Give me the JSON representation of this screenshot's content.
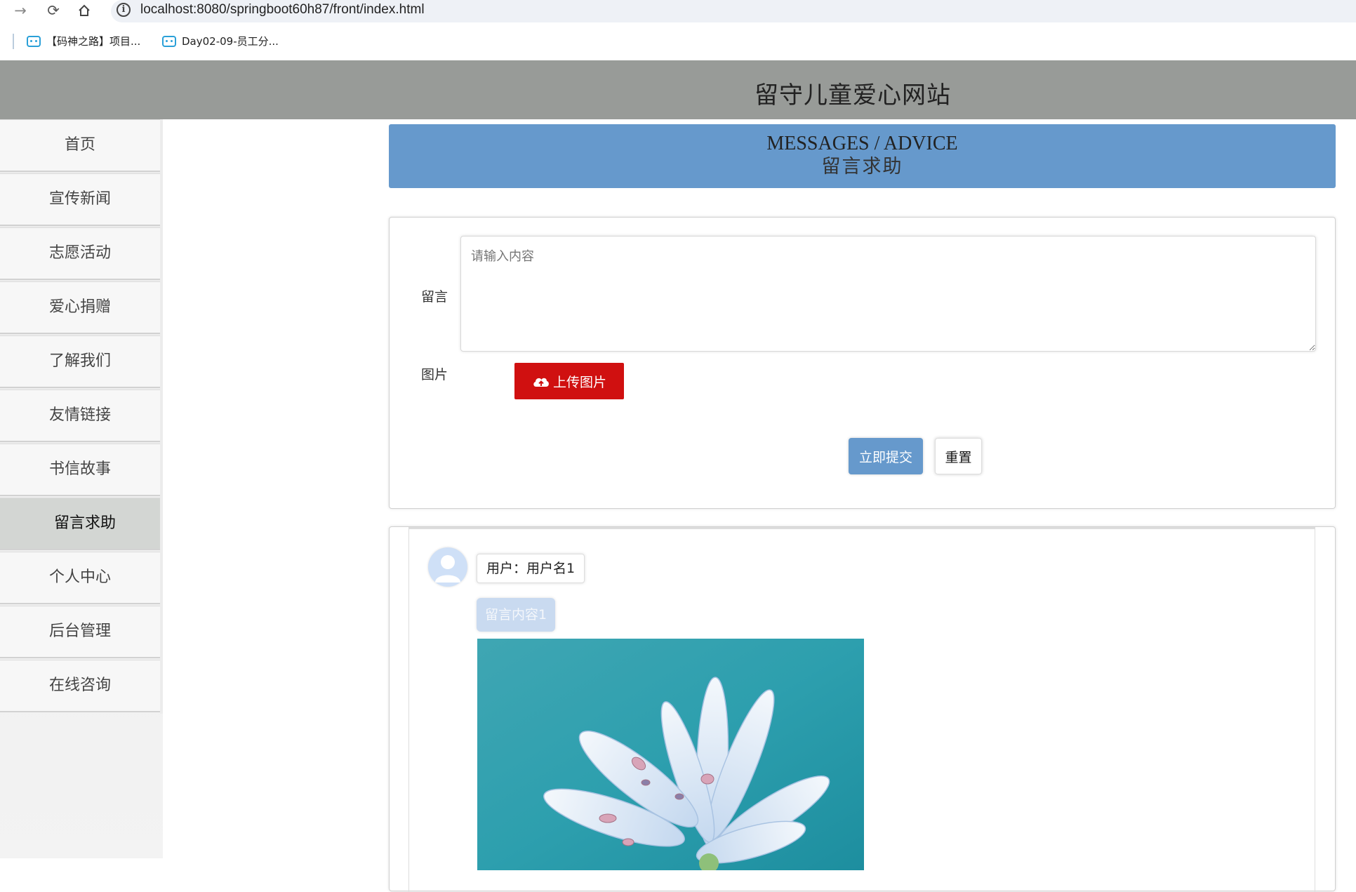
{
  "browser": {
    "url": "localhost:8080/springboot60h87/front/index.html",
    "bookmarks": [
      {
        "label": "【码神之路】项目..."
      },
      {
        "label": "Day02-09-员工分..."
      }
    ]
  },
  "site": {
    "title": "留守儿童爱心网站"
  },
  "sidebar": {
    "items": [
      {
        "label": "首页"
      },
      {
        "label": "宣传新闻"
      },
      {
        "label": "志愿活动"
      },
      {
        "label": "爱心捐赠"
      },
      {
        "label": "了解我们"
      },
      {
        "label": "友情链接"
      },
      {
        "label": "书信故事"
      },
      {
        "label": "留言求助"
      },
      {
        "label": "个人中心"
      },
      {
        "label": "后台管理"
      },
      {
        "label": "在线咨询"
      }
    ],
    "active_item": "留言求助"
  },
  "banner": {
    "title_en": "MESSAGES / ADVICE",
    "title_cn": "留言求助"
  },
  "form": {
    "message_label": "留言",
    "message_placeholder": "请输入内容",
    "image_label": "图片",
    "upload_label": "上传图片",
    "submit_label": "立即提交",
    "reset_label": "重置"
  },
  "messages": [
    {
      "user": "用户：用户名1",
      "content": "留言内容1",
      "image": "flower-photo"
    }
  ],
  "colors": {
    "header_bg": "#989b98",
    "banner_bg": "#6699cc",
    "upload_button": "#d01010",
    "submit_button": "#6699cc"
  }
}
